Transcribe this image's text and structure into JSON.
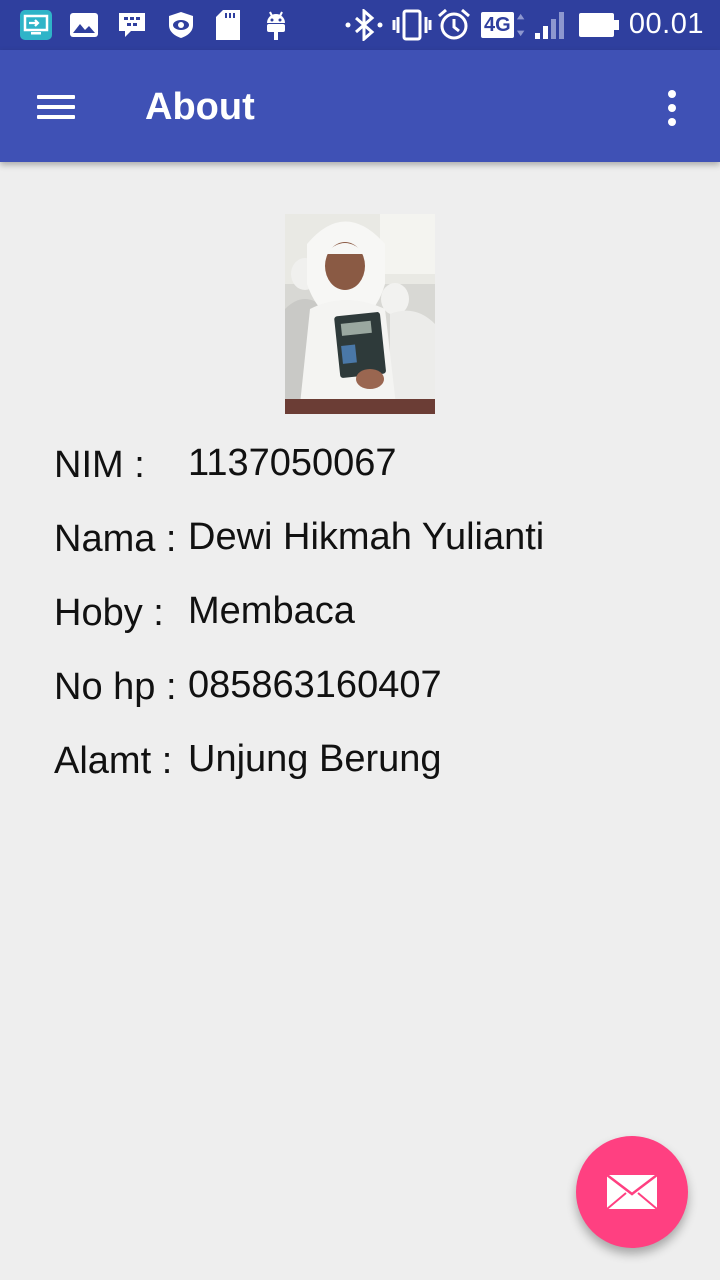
{
  "status_bar": {
    "time": "00.01",
    "network": "4G",
    "icons": [
      "screen-mirror-icon",
      "gallery-icon",
      "bbm-icon",
      "eye-shield-icon",
      "sd-card-icon",
      "android-debug-icon",
      "bluetooth-icon",
      "vibrate-icon",
      "alarm-icon",
      "network-4g-icon",
      "signal-icon",
      "battery-icon"
    ]
  },
  "app_bar": {
    "title": "About",
    "menu_icon": "hamburger-menu-icon",
    "overflow_icon": "more-vert-icon"
  },
  "profile": {
    "rows": [
      {
        "label": "NIM :",
        "value": "1137050067"
      },
      {
        "label": "Nama :",
        "value": "Dewi Hikmah Yulianti"
      },
      {
        "label": "Hoby :",
        "value": "Membaca"
      },
      {
        "label": "No hp :",
        "value": "085863160407"
      },
      {
        "label": "Alamt :",
        "value": "Unjung Berung"
      }
    ]
  },
  "fab": {
    "icon": "email-icon"
  },
  "colors": {
    "status_bar": "#2f3f9e",
    "app_bar": "#3f51b5",
    "background": "#eeeeee",
    "fab": "#ff4081"
  }
}
